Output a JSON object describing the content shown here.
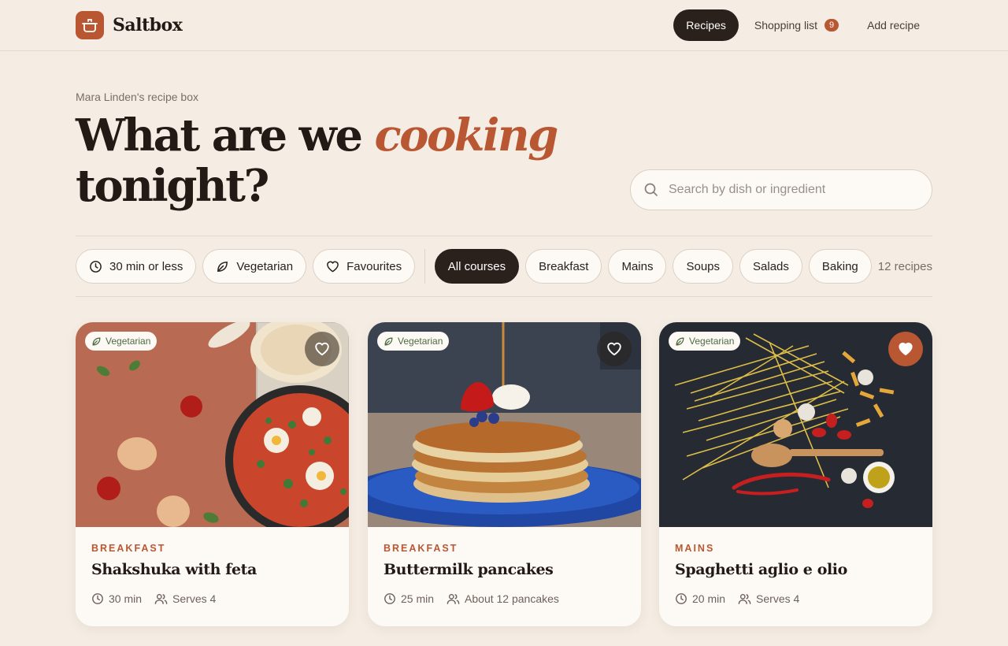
{
  "brand": {
    "name": "Saltbox"
  },
  "nav": {
    "items": [
      {
        "label": "Recipes"
      },
      {
        "label": "Shopping list",
        "badge": "9"
      },
      {
        "label": "Add recipe"
      }
    ]
  },
  "hero": {
    "eyebrow": "Mara Linden's recipe box",
    "headline_a": "What are we ",
    "headline_accent": "cooking",
    "headline_b": "tonight?"
  },
  "search": {
    "placeholder": "Search by dish or ingredient",
    "value": ""
  },
  "filters": {
    "toggles": [
      {
        "label": "30 min or less",
        "icon": "clock-icon"
      },
      {
        "label": "Vegetarian",
        "icon": "leaf-icon"
      },
      {
        "label": "Favourites",
        "icon": "heart-icon"
      }
    ],
    "courses": [
      "All courses",
      "Breakfast",
      "Mains",
      "Soups",
      "Salads",
      "Baking"
    ],
    "selected_course": "All courses",
    "count": "12 recipes"
  },
  "cards": [
    {
      "tag": "Vegetarian",
      "course": "BREAKFAST",
      "title": "Shakshuka with feta",
      "time": "30 min",
      "serves": "Serves 4",
      "favourite": false
    },
    {
      "tag": "Vegetarian",
      "course": "BREAKFAST",
      "title": "Buttermilk pancakes",
      "time": "25 min",
      "serves": "About 12 pancakes",
      "favourite": false
    },
    {
      "tag": "Vegetarian",
      "course": "MAINS",
      "title": "Spaghetti aglio e olio",
      "time": "20 min",
      "serves": "Serves 4",
      "favourite": true
    }
  ],
  "colors": {
    "accent": "#b95733",
    "ink": "#2a201c",
    "background": "#f5ede4",
    "tag_green": "#4e6b40"
  }
}
